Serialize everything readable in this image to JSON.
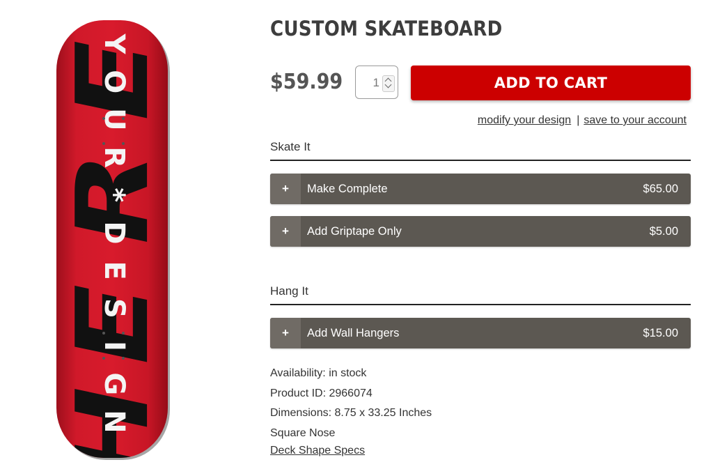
{
  "product": {
    "title": "CUSTOM SKATEBOARD",
    "price": "$59.99",
    "quantity": "1",
    "add_to_cart_label": "ADD TO CART",
    "deck_color": "#c8102e"
  },
  "deck": {
    "vertical_text": [
      "Y",
      "O",
      "U",
      "R",
      "*",
      "D",
      "E",
      "S",
      "I",
      "G",
      "N"
    ],
    "large_letters": [
      "H",
      "E",
      "R",
      "E"
    ]
  },
  "links": {
    "modify": "modify your design",
    "separator": "|",
    "save": "save to your account"
  },
  "sections": [
    {
      "heading": "Skate It",
      "options": [
        {
          "plus": "+",
          "label": "Make Complete",
          "price": "$65.00"
        },
        {
          "plus": "+",
          "label": "Add Griptape Only",
          "price": "$5.00"
        }
      ]
    },
    {
      "heading": "Hang It",
      "options": [
        {
          "plus": "+",
          "label": "Add Wall Hangers",
          "price": "$15.00"
        }
      ]
    }
  ],
  "specs": {
    "availability": "Availability: in stock",
    "product_id": "Product ID: 2966074",
    "dimensions": "Dimensions: 8.75 x 33.25 Inches",
    "nose": "Square Nose",
    "shape_link": "Deck Shape Specs"
  },
  "colors": {
    "accent": "#cc0000",
    "option_bg": "#5c5852",
    "option_plus_bg": "#706b65"
  }
}
